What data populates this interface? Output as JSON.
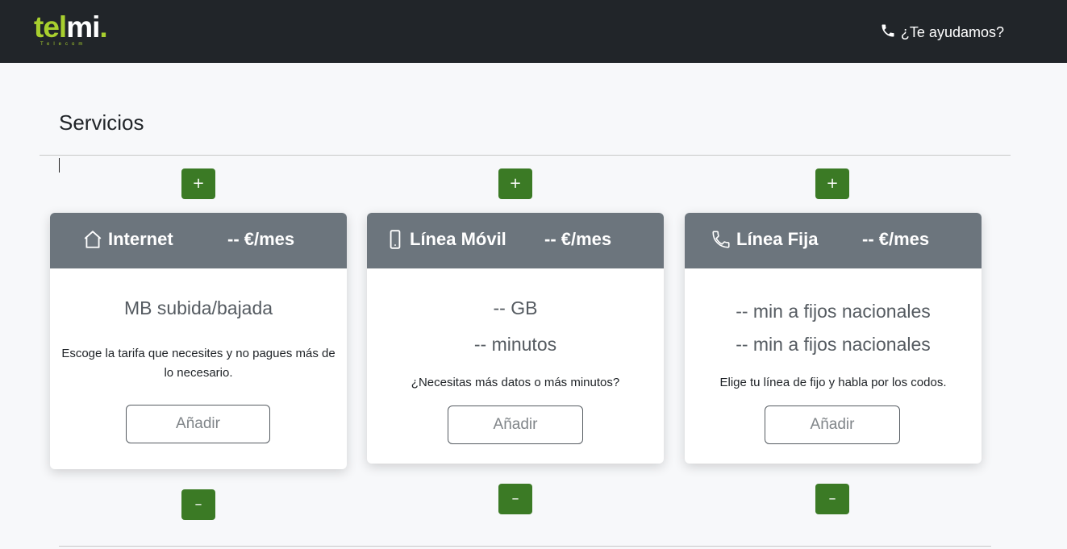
{
  "header": {
    "logo_part1": "tel",
    "logo_part2": "mi",
    "logo_dot": ".",
    "logo_sub": "Telecom",
    "help_icon": "phone-icon",
    "help_label": "¿Te ayudamos?"
  },
  "page": {
    "title": "Servicios"
  },
  "colors": {
    "navbar": "#212529",
    "brand_green": "#a8cf2e",
    "action_green": "#3b7a25",
    "card_header": "#6c757d"
  },
  "controls": {
    "plus_label": "+",
    "minus_label": "–"
  },
  "cards": [
    {
      "icon": "house-icon",
      "name": "Internet",
      "price": "-- €/mes",
      "line1": "MB subida/bajada",
      "description": "Escoge la tarifa que necesites y no pagues más de lo necesario.",
      "button": "Añadir"
    },
    {
      "icon": "mobile-phone-icon",
      "name": "Línea Móvil",
      "price": "-- €/mes",
      "line1": "-- GB",
      "line2": "-- minutos",
      "description": "¿Necesitas más datos o más minutos?",
      "button": "Añadir"
    },
    {
      "icon": "telephone-icon",
      "name": "Línea Fija",
      "price": "-- €/mes",
      "line1": "-- min a fijos nacionales",
      "line2": "-- min a fijos nacionales",
      "description": "Elige tu línea de fijo y habla por los codos.",
      "button": "Añadir"
    }
  ]
}
